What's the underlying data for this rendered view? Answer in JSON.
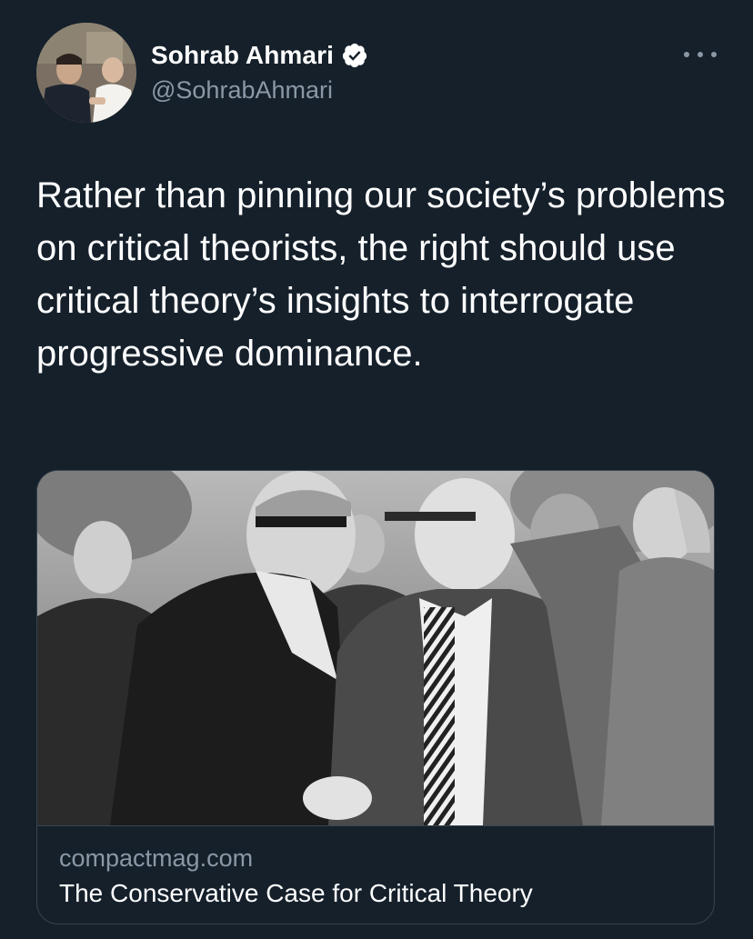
{
  "tweet": {
    "author": {
      "display_name": "Sohrab Ahmari",
      "handle": "@SohrabAhmari",
      "verified": true,
      "avatar_icon": "avatar-photo"
    },
    "more_icon": "more-options-icon",
    "text": "Rather than pinning our society’s problems on critical theorists, the right should use critical theory’s insights to interrogate progressive dominance."
  },
  "link_card": {
    "image_icon": "black-and-white-photo",
    "domain": "compactmag.com",
    "title": "The Conservative Case for Critical Theory"
  },
  "colors": {
    "background": "#15202b",
    "primary_text": "#ffffff",
    "secondary_text": "#8b98a5",
    "border": "#38444d",
    "verified_badge": "#ffffff"
  }
}
